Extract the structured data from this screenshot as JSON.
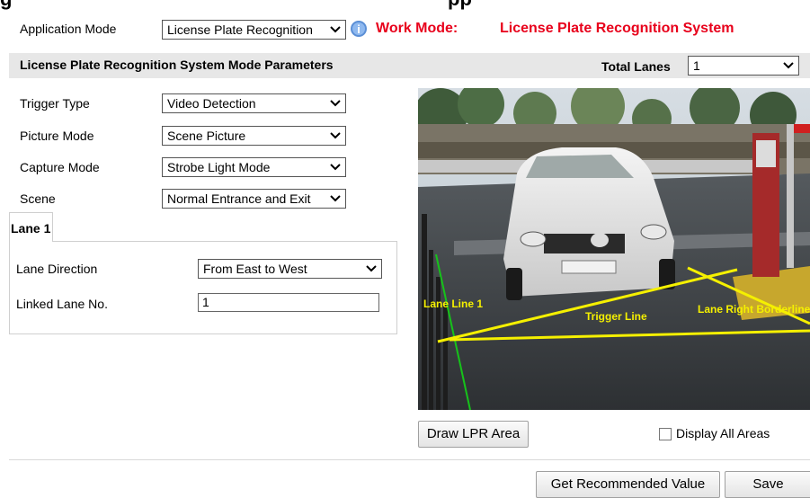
{
  "header": {
    "heading_fragment": "g",
    "heading_fragment_right": "pp",
    "app_mode_label": "Application Mode",
    "app_mode_value": "License Plate Recognition",
    "work_mode_label": "Work Mode:",
    "work_mode_value": "License Plate Recognition System"
  },
  "section": {
    "title": "License Plate Recognition System Mode Parameters",
    "total_lanes_label": "Total Lanes",
    "total_lanes_value": "1"
  },
  "params": {
    "trigger_type_label": "Trigger Type",
    "trigger_type_value": "Video Detection",
    "picture_mode_label": "Picture Mode",
    "picture_mode_value": "Scene Picture",
    "capture_mode_label": "Capture Mode",
    "capture_mode_value": "Strobe Light Mode",
    "scene_label": "Scene",
    "scene_value": "Normal Entrance and Exit"
  },
  "lane_tab": {
    "label": "Lane 1",
    "direction_label": "Lane Direction",
    "direction_value": "From East to West",
    "linked_label": "Linked Lane No.",
    "linked_value": "1"
  },
  "video": {
    "lane_line_label": "Lane Line 1",
    "trigger_line_label": "Trigger Line",
    "right_border_label": "Lane Right Borderline"
  },
  "actions": {
    "draw_lpr_area": "Draw LPR Area",
    "display_all_areas": "Display All Areas",
    "get_recommended": "Get Recommended Value",
    "save": "Save"
  },
  "colors": {
    "accent_red": "#e8001b",
    "overlay_yellow": "#f5f000",
    "lane_green": "#16c21a"
  }
}
